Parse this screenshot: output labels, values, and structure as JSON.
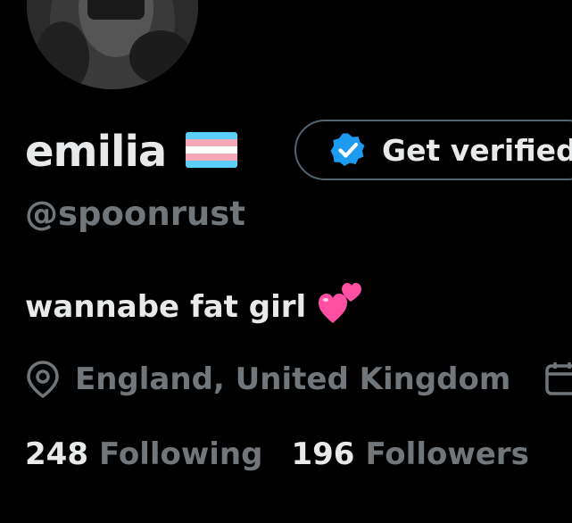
{
  "profile": {
    "display_name": "emilia",
    "handle": "@spoonrust",
    "flag_icon": "transgender-flag-emoji",
    "bio": "wannabe fat girl",
    "bio_emoji_icon": "two-hearts-emoji",
    "location": "England, United Kingdom"
  },
  "verify_button": {
    "label": "Get verified",
    "icon": "verified-badge-icon"
  },
  "stats": {
    "following_count": "248",
    "following_label": "Following",
    "followers_count": "196",
    "followers_label": "Followers"
  },
  "colors": {
    "background": "#000000",
    "primary_text": "#e7e9ea",
    "secondary_text": "#71767b",
    "button_border": "#536471",
    "verified_blue": "#1d9bf0",
    "flag_blue": "#5bcefa",
    "flag_pink": "#f5a9b8",
    "flag_white": "#ffffff",
    "heart_pink": "#ff4fa3"
  }
}
